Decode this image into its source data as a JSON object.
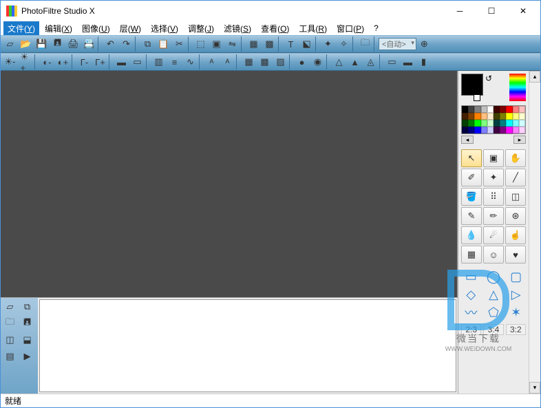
{
  "title": "PhotoFiltre Studio X",
  "menus": [
    {
      "label": "文件",
      "key": "Y",
      "active": true
    },
    {
      "label": "编辑",
      "key": "X"
    },
    {
      "label": "图像",
      "key": "U"
    },
    {
      "label": "层",
      "key": "W"
    },
    {
      "label": "选择",
      "key": "V"
    },
    {
      "label": "调整",
      "key": "J"
    },
    {
      "label": "滤镜",
      "key": "S"
    },
    {
      "label": "查看",
      "key": "O"
    },
    {
      "label": "工具",
      "key": "R"
    },
    {
      "label": "窗口",
      "key": "P"
    },
    {
      "label": "?",
      "key": ""
    }
  ],
  "zoom_dropdown": "<自动>",
  "status": "就绪",
  "watermark": {
    "text": "微当下载",
    "url": "WWW.WEIDOWN.COM"
  },
  "palette_colors": [
    "#000",
    "#404040",
    "#808080",
    "#c0c0c0",
    "#fff",
    "#400000",
    "#800000",
    "#f00",
    "#ff8080",
    "#ffc0c0",
    "#402000",
    "#804000",
    "#ff8000",
    "#ffc080",
    "#ffecd0",
    "#404000",
    "#808000",
    "#ff0",
    "#ffff80",
    "#ffffd0",
    "#004000",
    "#008000",
    "#0f0",
    "#80ff80",
    "#d0ffd0",
    "#004040",
    "#008080",
    "#0ff",
    "#80ffff",
    "#d0ffff",
    "#000040",
    "#000080",
    "#00f",
    "#8080ff",
    "#d0d0ff",
    "#400040",
    "#800080",
    "#f0f",
    "#ff80ff",
    "#ffd0ff"
  ],
  "aspect_ratios": [
    "2:3",
    "3:4",
    "3:2"
  ],
  "toolbar1_icons": [
    "new",
    "open",
    "save",
    "save-as",
    "print",
    "twain",
    "sep",
    "undo",
    "redo",
    "sep",
    "copy",
    "paste",
    "cut",
    "sep",
    "resize",
    "crop",
    "flip-h",
    "sep",
    "rgb",
    "channels",
    "sep",
    "text",
    "transform",
    "sep",
    "plugin1",
    "plugin2",
    "sep",
    "browse",
    "sep",
    "zoom-dropdown",
    "zoom-in"
  ],
  "toolbar2_icons": [
    "bright-minus",
    "bright-plus",
    "sep",
    "contrast-minus",
    "contrast-plus",
    "sep",
    "gamma-minus",
    "gamma-plus",
    "sep",
    "sat-minus",
    "sat-plus",
    "sep",
    "histogram",
    "levels",
    "curves",
    "sep",
    "auto1",
    "auto2",
    "sep",
    "grid1",
    "grid2",
    "grid3",
    "sep",
    "blur1",
    "blur2",
    "sep",
    "sharpen1",
    "sharpen2",
    "sharpen3",
    "sep",
    "fx1",
    "fx2",
    "fx3"
  ],
  "layer_tool_icons": [
    "layer-new",
    "layer-dup",
    "layer-folder",
    "layer-save",
    "layer-mask",
    "layer-merge",
    "layer-flatten",
    "layer-play"
  ],
  "tool_grid": [
    "pointer",
    "crop-tool",
    "hand",
    "eyedropper",
    "wand",
    "line",
    "bucket",
    "spray",
    "eraser",
    "brush",
    "adv-brush",
    "clone",
    "blur-tool",
    "smudge",
    "finger",
    "pattern",
    "retouch",
    "heart"
  ],
  "shapes": [
    "rect",
    "ellipse",
    "rounded",
    "diamond",
    "triangle",
    "triangle-r",
    "lasso",
    "polygon",
    "star"
  ]
}
